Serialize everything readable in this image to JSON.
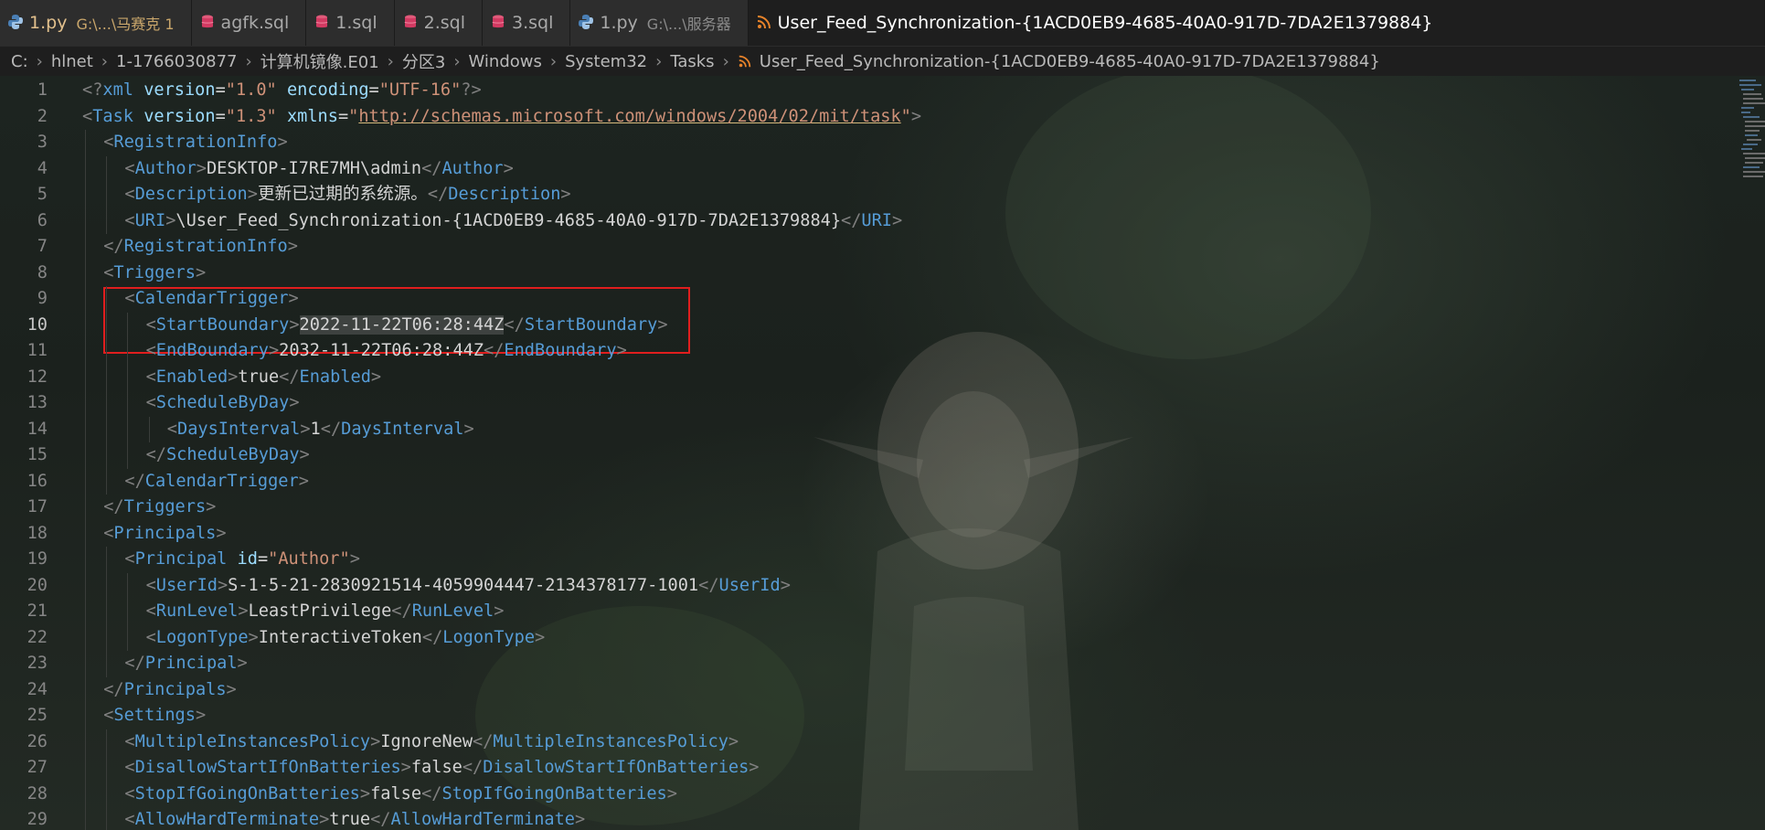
{
  "tabs": [
    {
      "label": "1.py",
      "description": "G:\\...\\马赛克 1",
      "icon": "python-icon",
      "state": "warn"
    },
    {
      "label": "agfk.sql",
      "icon": "database-icon",
      "state": ""
    },
    {
      "label": "1.sql",
      "icon": "database-icon",
      "state": ""
    },
    {
      "label": "2.sql",
      "icon": "database-icon",
      "state": ""
    },
    {
      "label": "3.sql",
      "icon": "database-icon",
      "state": ""
    },
    {
      "label": "1.py",
      "description": "G:\\...\\服务器",
      "icon": "python-icon",
      "state": ""
    },
    {
      "label": "User_Feed_Synchronization-{1ACD0EB9-4685-40A0-917D-7DA2E1379884}",
      "icon": "rss-icon",
      "state": "active"
    }
  ],
  "breadcrumb": [
    "C:",
    "hlnet",
    "1-1766030877",
    "计算机镜像.E01",
    "分区3",
    "Windows",
    "System32",
    "Tasks",
    "User_Feed_Synchronization-{1ACD0EB9-4685-40A0-917D-7DA2E1379884}"
  ],
  "editor": {
    "current_line": 10,
    "highlight_lines": [
      9,
      11
    ],
    "lines": [
      {
        "n": "1",
        "indent": 0,
        "tokens": [
          [
            "p",
            "<?"
          ],
          [
            "t",
            "xml"
          ],
          [
            "x",
            " "
          ],
          [
            "a",
            "version"
          ],
          [
            "x",
            "="
          ],
          [
            "s",
            "\"1.0\""
          ],
          [
            "x",
            " "
          ],
          [
            "a",
            "encoding"
          ],
          [
            "x",
            "="
          ],
          [
            "s",
            "\"UTF-16\""
          ],
          [
            "p",
            "?>"
          ]
        ]
      },
      {
        "n": "2",
        "indent": 0,
        "tokens": [
          [
            "p",
            "<"
          ],
          [
            "t",
            "Task"
          ],
          [
            "x",
            " "
          ],
          [
            "a",
            "version"
          ],
          [
            "x",
            "="
          ],
          [
            "s",
            "\"1.3\""
          ],
          [
            "x",
            " "
          ],
          [
            "a",
            "xmlns"
          ],
          [
            "x",
            "="
          ],
          [
            "s",
            "\""
          ],
          [
            "u",
            "http://schemas.microsoft.com/windows/2004/02/mit/task"
          ],
          [
            "s",
            "\""
          ],
          [
            "p",
            ">"
          ]
        ]
      },
      {
        "n": "3",
        "indent": 1,
        "tokens": [
          [
            "p",
            "<"
          ],
          [
            "t",
            "RegistrationInfo"
          ],
          [
            "p",
            ">"
          ]
        ]
      },
      {
        "n": "4",
        "indent": 2,
        "tokens": [
          [
            "p",
            "<"
          ],
          [
            "t",
            "Author"
          ],
          [
            "p",
            ">"
          ],
          [
            "x",
            "DESKTOP-I7RE7MH\\admin"
          ],
          [
            "p",
            "</"
          ],
          [
            "t",
            "Author"
          ],
          [
            "p",
            ">"
          ]
        ]
      },
      {
        "n": "5",
        "indent": 2,
        "tokens": [
          [
            "p",
            "<"
          ],
          [
            "t",
            "Description"
          ],
          [
            "p",
            ">"
          ],
          [
            "x",
            "更新已过期的系统源。"
          ],
          [
            "p",
            "</"
          ],
          [
            "t",
            "Description"
          ],
          [
            "p",
            ">"
          ]
        ]
      },
      {
        "n": "6",
        "indent": 2,
        "tokens": [
          [
            "p",
            "<"
          ],
          [
            "t",
            "URI"
          ],
          [
            "p",
            ">"
          ],
          [
            "x",
            "\\User_Feed_Synchronization-{1ACD0EB9-4685-40A0-917D-7DA2E1379884}"
          ],
          [
            "p",
            "</"
          ],
          [
            "t",
            "URI"
          ],
          [
            "p",
            ">"
          ]
        ]
      },
      {
        "n": "7",
        "indent": 1,
        "tokens": [
          [
            "p",
            "</"
          ],
          [
            "t",
            "RegistrationInfo"
          ],
          [
            "p",
            ">"
          ]
        ]
      },
      {
        "n": "8",
        "indent": 1,
        "tokens": [
          [
            "p",
            "<"
          ],
          [
            "t",
            "Triggers"
          ],
          [
            "p",
            ">"
          ]
        ]
      },
      {
        "n": "9",
        "indent": 2,
        "tokens": [
          [
            "p",
            "<"
          ],
          [
            "t",
            "CalendarTrigger"
          ],
          [
            "p",
            ">"
          ]
        ]
      },
      {
        "n": "10",
        "indent": 3,
        "tokens": [
          [
            "p",
            "<"
          ],
          [
            "t",
            "StartBoundary"
          ],
          [
            "p",
            ">"
          ],
          [
            "x sel",
            "2022-11-22T06:28:44Z"
          ],
          [
            "p",
            "</"
          ],
          [
            "t",
            "StartBoundary"
          ],
          [
            "p",
            ">"
          ]
        ]
      },
      {
        "n": "11",
        "indent": 3,
        "tokens": [
          [
            "p",
            "<"
          ],
          [
            "t",
            "EndBoundary"
          ],
          [
            "p",
            ">"
          ],
          [
            "x",
            "2032-11-22T06:28:44Z"
          ],
          [
            "p",
            "</"
          ],
          [
            "t",
            "EndBoundary"
          ],
          [
            "p",
            ">"
          ]
        ]
      },
      {
        "n": "12",
        "indent": 3,
        "tokens": [
          [
            "p",
            "<"
          ],
          [
            "t",
            "Enabled"
          ],
          [
            "p",
            ">"
          ],
          [
            "x",
            "true"
          ],
          [
            "p",
            "</"
          ],
          [
            "t",
            "Enabled"
          ],
          [
            "p",
            ">"
          ]
        ]
      },
      {
        "n": "13",
        "indent": 3,
        "tokens": [
          [
            "p",
            "<"
          ],
          [
            "t",
            "ScheduleByDay"
          ],
          [
            "p",
            ">"
          ]
        ]
      },
      {
        "n": "14",
        "indent": 4,
        "tokens": [
          [
            "p",
            "<"
          ],
          [
            "t",
            "DaysInterval"
          ],
          [
            "p",
            ">"
          ],
          [
            "x",
            "1"
          ],
          [
            "p",
            "</"
          ],
          [
            "t",
            "DaysInterval"
          ],
          [
            "p",
            ">"
          ]
        ]
      },
      {
        "n": "15",
        "indent": 3,
        "tokens": [
          [
            "p",
            "</"
          ],
          [
            "t",
            "ScheduleByDay"
          ],
          [
            "p",
            ">"
          ]
        ]
      },
      {
        "n": "16",
        "indent": 2,
        "tokens": [
          [
            "p",
            "</"
          ],
          [
            "t",
            "CalendarTrigger"
          ],
          [
            "p",
            ">"
          ]
        ]
      },
      {
        "n": "17",
        "indent": 1,
        "tokens": [
          [
            "p",
            "</"
          ],
          [
            "t",
            "Triggers"
          ],
          [
            "p",
            ">"
          ]
        ]
      },
      {
        "n": "18",
        "indent": 1,
        "tokens": [
          [
            "p",
            "<"
          ],
          [
            "t",
            "Principals"
          ],
          [
            "p",
            ">"
          ]
        ]
      },
      {
        "n": "19",
        "indent": 2,
        "tokens": [
          [
            "p",
            "<"
          ],
          [
            "t",
            "Principal"
          ],
          [
            "x",
            " "
          ],
          [
            "a",
            "id"
          ],
          [
            "x",
            "="
          ],
          [
            "s",
            "\"Author\""
          ],
          [
            "p",
            ">"
          ]
        ]
      },
      {
        "n": "20",
        "indent": 3,
        "tokens": [
          [
            "p",
            "<"
          ],
          [
            "t",
            "UserId"
          ],
          [
            "p",
            ">"
          ],
          [
            "x",
            "S-1-5-21-2830921514-4059904447-2134378177-1001"
          ],
          [
            "p",
            "</"
          ],
          [
            "t",
            "UserId"
          ],
          [
            "p",
            ">"
          ]
        ]
      },
      {
        "n": "21",
        "indent": 3,
        "tokens": [
          [
            "p",
            "<"
          ],
          [
            "t",
            "RunLevel"
          ],
          [
            "p",
            ">"
          ],
          [
            "x",
            "LeastPrivilege"
          ],
          [
            "p",
            "</"
          ],
          [
            "t",
            "RunLevel"
          ],
          [
            "p",
            ">"
          ]
        ]
      },
      {
        "n": "22",
        "indent": 3,
        "tokens": [
          [
            "p",
            "<"
          ],
          [
            "t",
            "LogonType"
          ],
          [
            "p",
            ">"
          ],
          [
            "x",
            "InteractiveToken"
          ],
          [
            "p",
            "</"
          ],
          [
            "t",
            "LogonType"
          ],
          [
            "p",
            ">"
          ]
        ]
      },
      {
        "n": "23",
        "indent": 2,
        "tokens": [
          [
            "p",
            "</"
          ],
          [
            "t",
            "Principal"
          ],
          [
            "p",
            ">"
          ]
        ]
      },
      {
        "n": "24",
        "indent": 1,
        "tokens": [
          [
            "p",
            "</"
          ],
          [
            "t",
            "Principals"
          ],
          [
            "p",
            ">"
          ]
        ]
      },
      {
        "n": "25",
        "indent": 1,
        "tokens": [
          [
            "p",
            "<"
          ],
          [
            "t",
            "Settings"
          ],
          [
            "p",
            ">"
          ]
        ]
      },
      {
        "n": "26",
        "indent": 2,
        "tokens": [
          [
            "p",
            "<"
          ],
          [
            "t",
            "MultipleInstancesPolicy"
          ],
          [
            "p",
            ">"
          ],
          [
            "x",
            "IgnoreNew"
          ],
          [
            "p",
            "</"
          ],
          [
            "t",
            "MultipleInstancesPolicy"
          ],
          [
            "p",
            ">"
          ]
        ]
      },
      {
        "n": "27",
        "indent": 2,
        "tokens": [
          [
            "p",
            "<"
          ],
          [
            "t",
            "DisallowStartIfOnBatteries"
          ],
          [
            "p",
            ">"
          ],
          [
            "x",
            "false"
          ],
          [
            "p",
            "</"
          ],
          [
            "t",
            "DisallowStartIfOnBatteries"
          ],
          [
            "p",
            ">"
          ]
        ]
      },
      {
        "n": "28",
        "indent": 2,
        "tokens": [
          [
            "p",
            "<"
          ],
          [
            "t",
            "StopIfGoingOnBatteries"
          ],
          [
            "p",
            ">"
          ],
          [
            "x",
            "false"
          ],
          [
            "p",
            "</"
          ],
          [
            "t",
            "StopIfGoingOnBatteries"
          ],
          [
            "p",
            ">"
          ]
        ]
      },
      {
        "n": "29",
        "indent": 2,
        "tokens": [
          [
            "p",
            "<"
          ],
          [
            "t",
            "AllowHardTerminate"
          ],
          [
            "p",
            ">"
          ],
          [
            "x",
            "true"
          ],
          [
            "p",
            "</"
          ],
          [
            "t",
            "AllowHardTerminate"
          ],
          [
            "p",
            ">"
          ]
        ]
      }
    ]
  }
}
